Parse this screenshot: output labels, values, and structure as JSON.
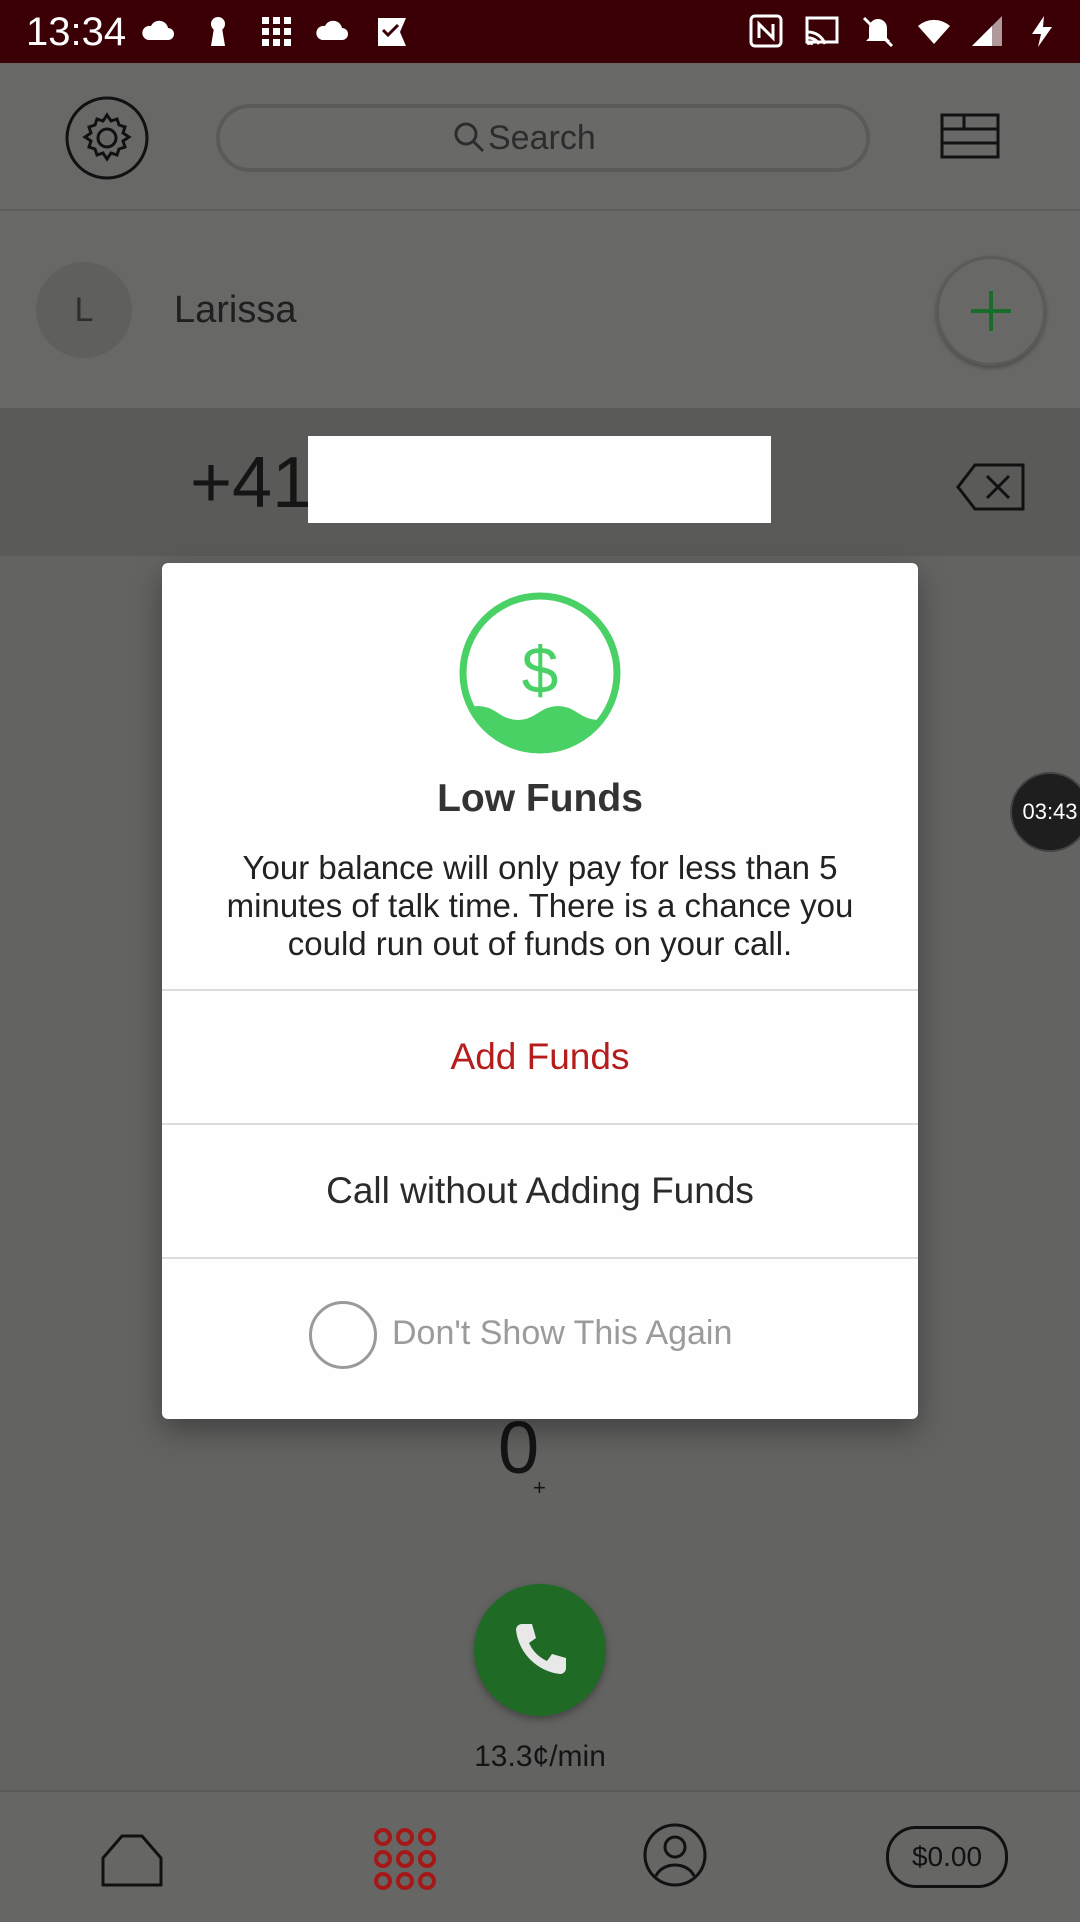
{
  "status_bar": {
    "time": "13:34"
  },
  "toolbar": {
    "search_placeholder": "Search"
  },
  "contact": {
    "initial": "L",
    "name": "Larissa"
  },
  "dialer": {
    "country_code": "+41",
    "digit_zero": "0",
    "zero_sub": "+",
    "rate": "13.3¢/min"
  },
  "timer_bubble": {
    "text": "03:43"
  },
  "dialog": {
    "title": "Low Funds",
    "message": "Your balance will only pay for less than 5 minutes of talk time. There is a chance you could run out of funds on your call.",
    "add_funds_label": "Add Funds",
    "call_without_label": "Call without Adding Funds",
    "dont_show_label": "Don't Show This Again"
  },
  "bottom_nav": {
    "balance": "$0.00"
  },
  "colors": {
    "accent_red": "#b51c1c",
    "green": "#4ad165",
    "call_green": "#1f6b26"
  }
}
